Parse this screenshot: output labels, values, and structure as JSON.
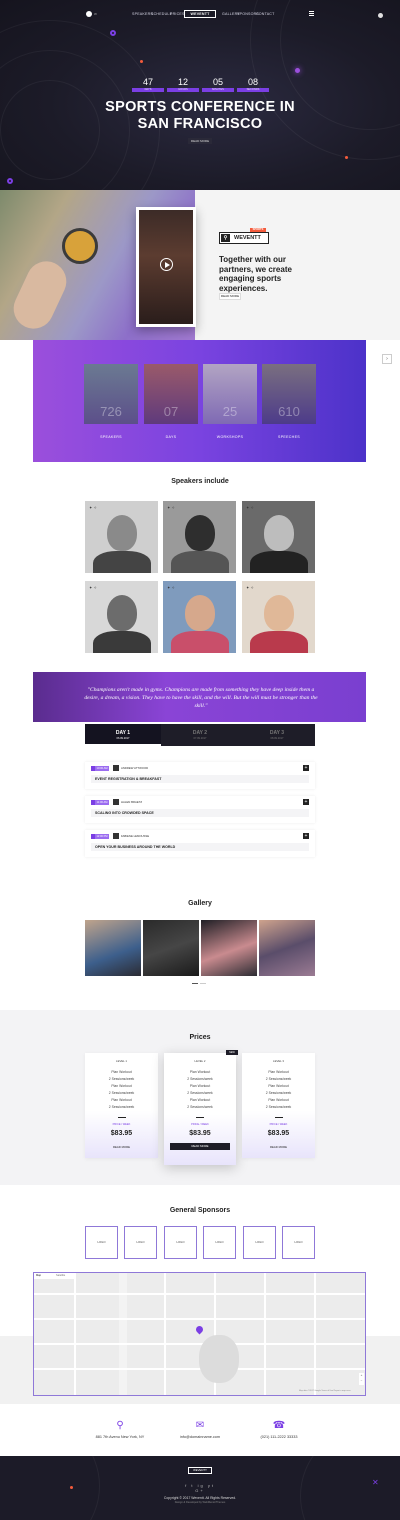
{
  "nav": {
    "logo_text": "W",
    "items": [
      "SPEAKERS",
      "SCHEDULE",
      "PRICES",
      "GALLERY",
      "SPONSORS",
      "CONTACT"
    ],
    "brand": "WEVENTT",
    "menu_icon": "hamburger-icon"
  },
  "hero": {
    "countdown": [
      {
        "value": "47",
        "unit": "DAYS"
      },
      {
        "value": "12",
        "unit": "HOURS"
      },
      {
        "value": "05",
        "unit": "MINUTES"
      },
      {
        "value": "08",
        "unit": "SECONDS"
      }
    ],
    "title_line1": "SPORTS CONFERENCE IN",
    "title_line2": "SAN FRANCISCO",
    "button": "READ MORE"
  },
  "about": {
    "logo_brand": "WEVENTT",
    "logo_tag": "SPORTS",
    "heading": "Together with our partners, we create engaging sports experiences.",
    "button": "READ MORE",
    "video_icon": "play-icon"
  },
  "stats": [
    {
      "value": "726",
      "label": "SPEAKERS"
    },
    {
      "value": "07",
      "label": "DAYS"
    },
    {
      "value": "25",
      "label": "WORKSHOPS"
    },
    {
      "value": "610",
      "label": "SPEECHES"
    }
  ],
  "speakers": {
    "title": "Speakers include"
  },
  "quote": {
    "text": "\"Champions aren't made in gyms. Champions are made from something they have deep inside them a desire, a dream, a vision. They have to have the skill, and the will. But the will must be stronger than the skill.\""
  },
  "schedule": {
    "days": [
      {
        "label": "DAY 1",
        "date": "06.09.2017"
      },
      {
        "label": "DAY 2",
        "date": "07.09.2017"
      },
      {
        "label": "DAY 3",
        "date": "08.09.2017"
      }
    ],
    "events": [
      {
        "time": "10:00 AM",
        "speaker": "ANDREW ATTWOOD",
        "title": "EVENT REGISTRATION & BREAKFAST"
      },
      {
        "time": "11:00 AM",
        "speaker": "HALEN BRAETZ",
        "title": "SCALING INTO CROWDED SPACE"
      },
      {
        "time": "12:00 PM",
        "speaker": "FABIENE LEMOUSSE",
        "title": "OPEN YOUR BUSINESS AROUND THE WORLD"
      }
    ]
  },
  "gallery": {
    "title": "Gallery"
  },
  "prices": {
    "title": "Prices",
    "cards": [
      {
        "level": "LEVEL 1",
        "items": [
          "Plan Workout",
          "2 Sessions/week",
          "Plan Workout",
          "2 Sessions/week",
          "Plan Workout",
          "2 Sessions/week"
        ],
        "period": "PRICE / WEEK",
        "price": "$83.95",
        "button": "READ MORE"
      },
      {
        "level": "LEVEL 2",
        "items": [
          "Plan Workout",
          "2 Sessions/week",
          "Plan Workout",
          "2 Sessions/week",
          "Plan Workout",
          "2 Sessions/week"
        ],
        "period": "PRICE / WEEK",
        "price": "$83.95",
        "button": "READ MORE",
        "badge": "NEW"
      },
      {
        "level": "LEVEL 3",
        "items": [
          "Plan Workout",
          "2 Sessions/week",
          "Plan Workout",
          "2 Sessions/week",
          "Plan Workout",
          "2 Sessions/week"
        ],
        "period": "PRICE / WEEK",
        "price": "$83.95",
        "button": "READ MORE"
      }
    ]
  },
  "sponsors": {
    "title": "General Sponsors",
    "logos": [
      "LOGO",
      "LOGO",
      "LOGO",
      "LOGO",
      "LOGO",
      "LOGO"
    ]
  },
  "map": {
    "tabs": [
      "Map",
      "Satellite"
    ],
    "footer": "Map data ©2017 Google   Terms of Use   Report a map error"
  },
  "contact": [
    {
      "icon": "location-pin-icon",
      "text": "881 7th Avenu New York, NY"
    },
    {
      "icon": "mail-icon",
      "text": "info@domainname.com"
    },
    {
      "icon": "phone-icon",
      "text": "(021) 111-2222 33333"
    }
  ],
  "footer": {
    "brand": "WEVENTT",
    "social": [
      "f",
      "t",
      "ig",
      "yt",
      "G+"
    ],
    "copyright": "Copyright © 2017 Weventt. All Rights Reserved.",
    "credit": "Design & Developed by WebMentorThemes"
  },
  "colors": {
    "accent": "#7b3fe4",
    "dark": "#1c1b28",
    "orange": "#f45b3c"
  }
}
